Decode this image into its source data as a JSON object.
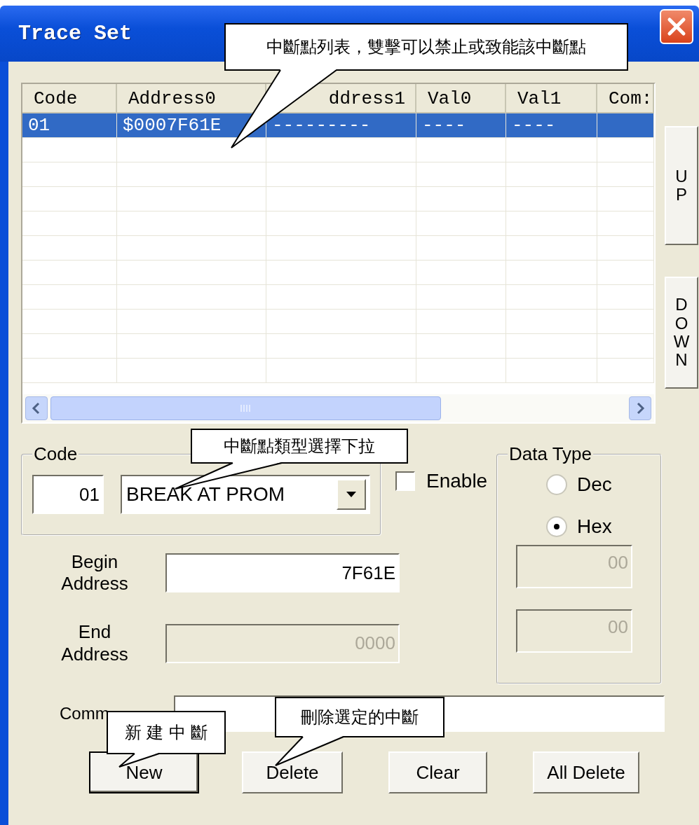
{
  "window": {
    "title": "Trace Set"
  },
  "table": {
    "columns": [
      "Code",
      "Address0",
      "ddress1",
      "Val0",
      "Val1",
      "Com:"
    ],
    "rows": [
      {
        "cells": [
          "01",
          "$0007F61E",
          "---------",
          "----",
          "----"
        ],
        "selected": true
      }
    ]
  },
  "side_buttons": [
    {
      "label": "UP"
    },
    {
      "label": "DOWN"
    }
  ],
  "code_group": {
    "title": "Code",
    "code": "01",
    "type": "BREAK AT PROM"
  },
  "enable": {
    "label": "Enable",
    "checked": false
  },
  "data_type": {
    "title": "Data Type",
    "options": [
      {
        "label": "Dec",
        "selected": false
      },
      {
        "label": "Hex",
        "selected": true
      }
    ],
    "fields": [
      {
        "value": "00",
        "disabled": true
      },
      {
        "value": "00",
        "disabled": true
      }
    ]
  },
  "address_fields": [
    {
      "label": "Begin Address",
      "value": "7F61E",
      "disabled": false
    },
    {
      "label": "End Address",
      "value": "0000",
      "disabled": true
    }
  ],
  "comment": {
    "label": "Comm"
  },
  "buttons": [
    {
      "label": "New",
      "default": true
    },
    {
      "label": "Delete",
      "default": false
    },
    {
      "label": "Clear",
      "default": false
    },
    {
      "label": "All Delete",
      "default": false
    }
  ],
  "callouts": [
    {
      "text": "中斷點列表，雙擊可以禁止或致能該中斷點"
    },
    {
      "text": "中斷點類型選擇下拉"
    },
    {
      "text": "新 建 中 斷"
    },
    {
      "text": "刪除選定的中斷"
    }
  ]
}
